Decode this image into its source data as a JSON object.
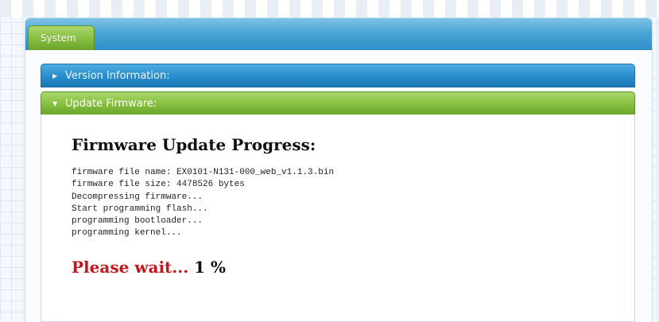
{
  "tabs": [
    {
      "label": "System",
      "active": true
    }
  ],
  "sections": {
    "version": {
      "label": "Version Information:",
      "expanded": false
    },
    "update": {
      "label": "Update Firmware:",
      "expanded": true
    }
  },
  "progress": {
    "heading": "Firmware Update Progress:",
    "log": [
      "firmware file name: EX0101-N131-000_web_v1.1.3.bin",
      "firmware file size: 4478526 bytes",
      "Decompressing firmware...",
      "Start programming flash...",
      "programming bootloader...",
      "programming kernel..."
    ],
    "wait_text": "Please wait...",
    "percent_text": "1 %",
    "percent": 1
  },
  "colors": {
    "tab_green": "#85bd3f",
    "accordion_blue": "#2a8fcd",
    "wait_red": "#c4161c"
  }
}
